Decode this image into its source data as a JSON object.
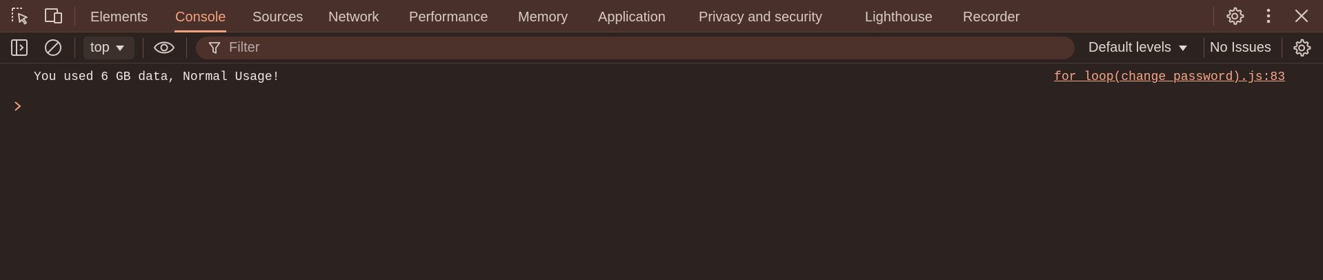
{
  "tabs": [
    {
      "label": "Elements",
      "active": false
    },
    {
      "label": "Console",
      "active": true
    },
    {
      "label": "Sources",
      "active": false
    },
    {
      "label": "Network",
      "active": false
    },
    {
      "label": "Performance",
      "active": false
    },
    {
      "label": "Memory",
      "active": false
    },
    {
      "label": "Application",
      "active": false
    },
    {
      "label": "Privacy and security",
      "active": false
    },
    {
      "label": "Lighthouse",
      "active": false
    },
    {
      "label": "Recorder",
      "active": false
    }
  ],
  "toolbar": {
    "context": "top",
    "filter_placeholder": "Filter",
    "levels_label": "Default levels",
    "issues_label": "No Issues"
  },
  "console": {
    "messages": [
      {
        "text": "You used 6 GB data, Normal Usage!",
        "source": "for loop(change password).js:83"
      }
    ]
  },
  "colors": {
    "accent": "#f0a27f",
    "topbar_bg": "#4a302a",
    "console_bg": "#2c2220",
    "filter_bg": "#4d322c"
  }
}
